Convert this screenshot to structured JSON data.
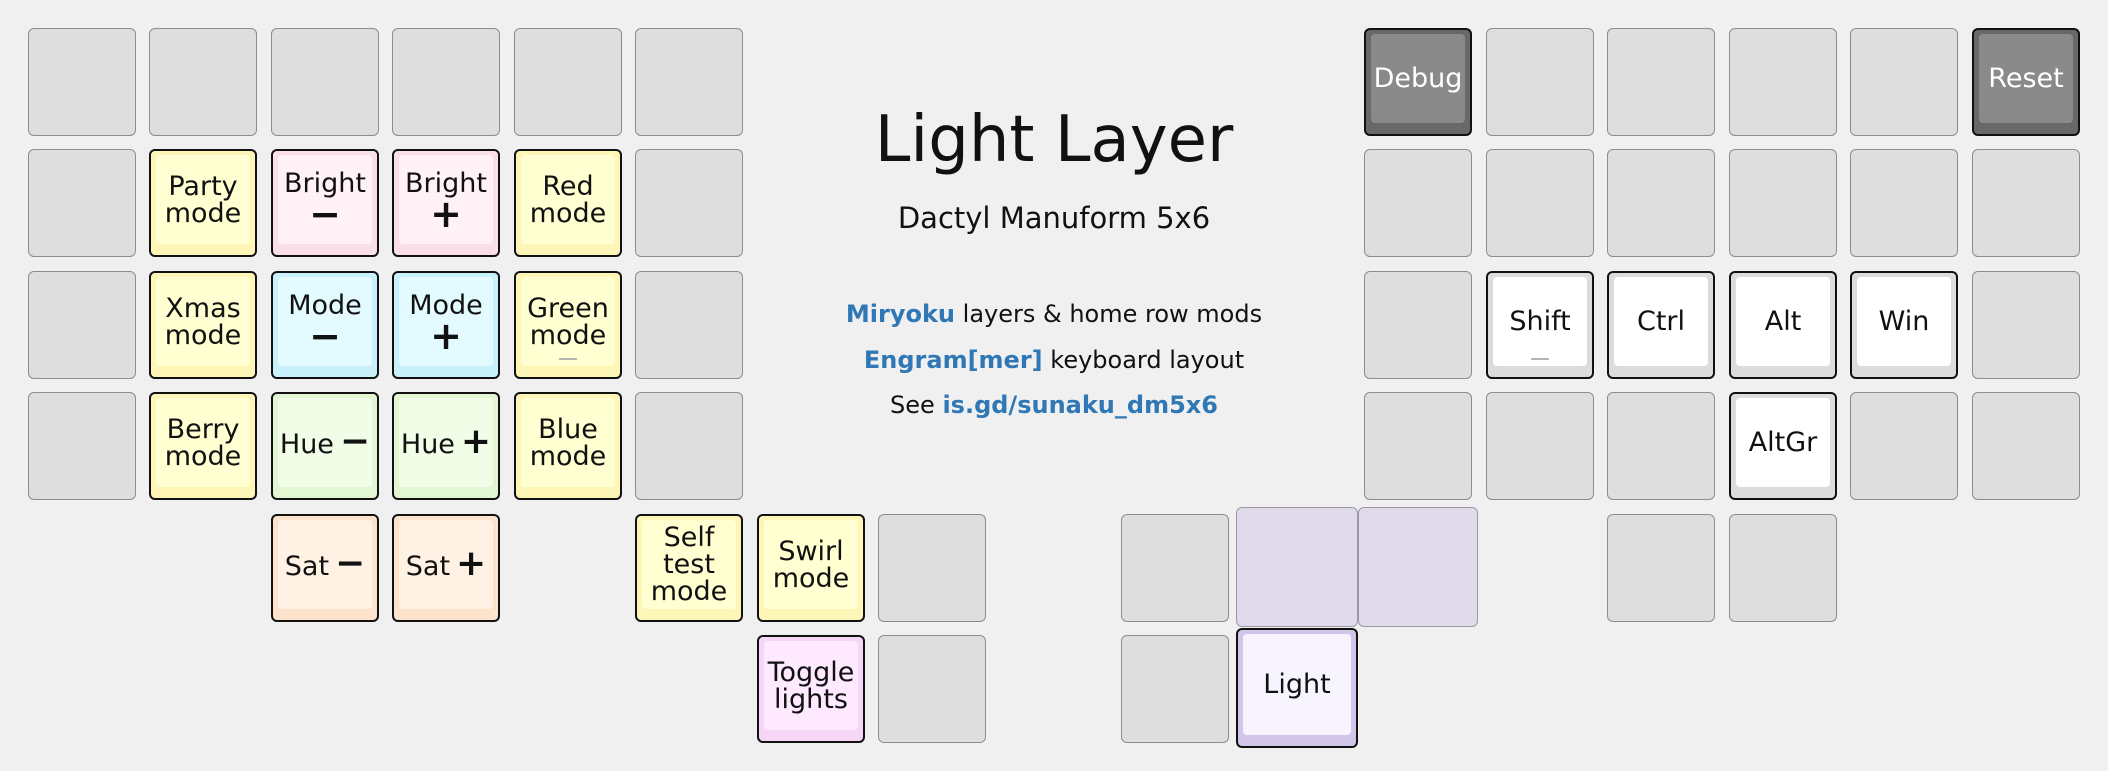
{
  "title": "Light Layer",
  "subtitle": "Dactyl Manuform 5x6",
  "info": [
    {
      "highlight": "Miryoku",
      "text": " layers & home row mods"
    },
    {
      "highlight": "Engram[mer]",
      "text": " keyboard layout"
    },
    {
      "prefix": "See ",
      "highlight": "is.gd/sunaku_dm5x6"
    }
  ],
  "colors": {
    "background": "#f0f0f0",
    "empty_key": "#dedede",
    "link": "#2f78b5",
    "yellow": "#fef6b6",
    "pink": "#fbdfe6",
    "cyan": "#c9f1fb",
    "green": "#e3f6d3",
    "peach": "#fde3cc",
    "magenta": "#f5d6f6",
    "dark": "#8a8a8a",
    "lavender": "#e1daea",
    "light_active": "#d1c5ea"
  },
  "icons": {
    "minus": "−",
    "plus": "+"
  },
  "keys": {
    "debug": "Debug",
    "reset": "Reset",
    "party_mode": [
      "Party",
      "mode"
    ],
    "bright_down": {
      "label": "Bright",
      "sym": "−"
    },
    "bright_up": {
      "label": "Bright",
      "sym": "+"
    },
    "red_mode": [
      "Red",
      "mode"
    ],
    "xmas_mode": [
      "Xmas",
      "mode"
    ],
    "mode_down": {
      "label": "Mode",
      "sym": "−"
    },
    "mode_up": {
      "label": "Mode",
      "sym": "+"
    },
    "green_mode": [
      "Green",
      "mode"
    ],
    "berry_mode": [
      "Berry",
      "mode"
    ],
    "hue_down": {
      "label": "Hue",
      "sym": "−"
    },
    "hue_up": {
      "label": "Hue",
      "sym": "+"
    },
    "blue_mode": [
      "Blue",
      "mode"
    ],
    "sat_down": {
      "label": "Sat",
      "sym": "−"
    },
    "sat_up": {
      "label": "Sat",
      "sym": "+"
    },
    "self_test_mode": [
      "Self",
      "test",
      "mode"
    ],
    "swirl_mode": [
      "Swirl",
      "mode"
    ],
    "toggle_lights": [
      "Toggle",
      "lights"
    ],
    "shift": "Shift",
    "ctrl": "Ctrl",
    "alt": "Alt",
    "win": "Win",
    "altgr": "AltGr",
    "light": "Light"
  }
}
